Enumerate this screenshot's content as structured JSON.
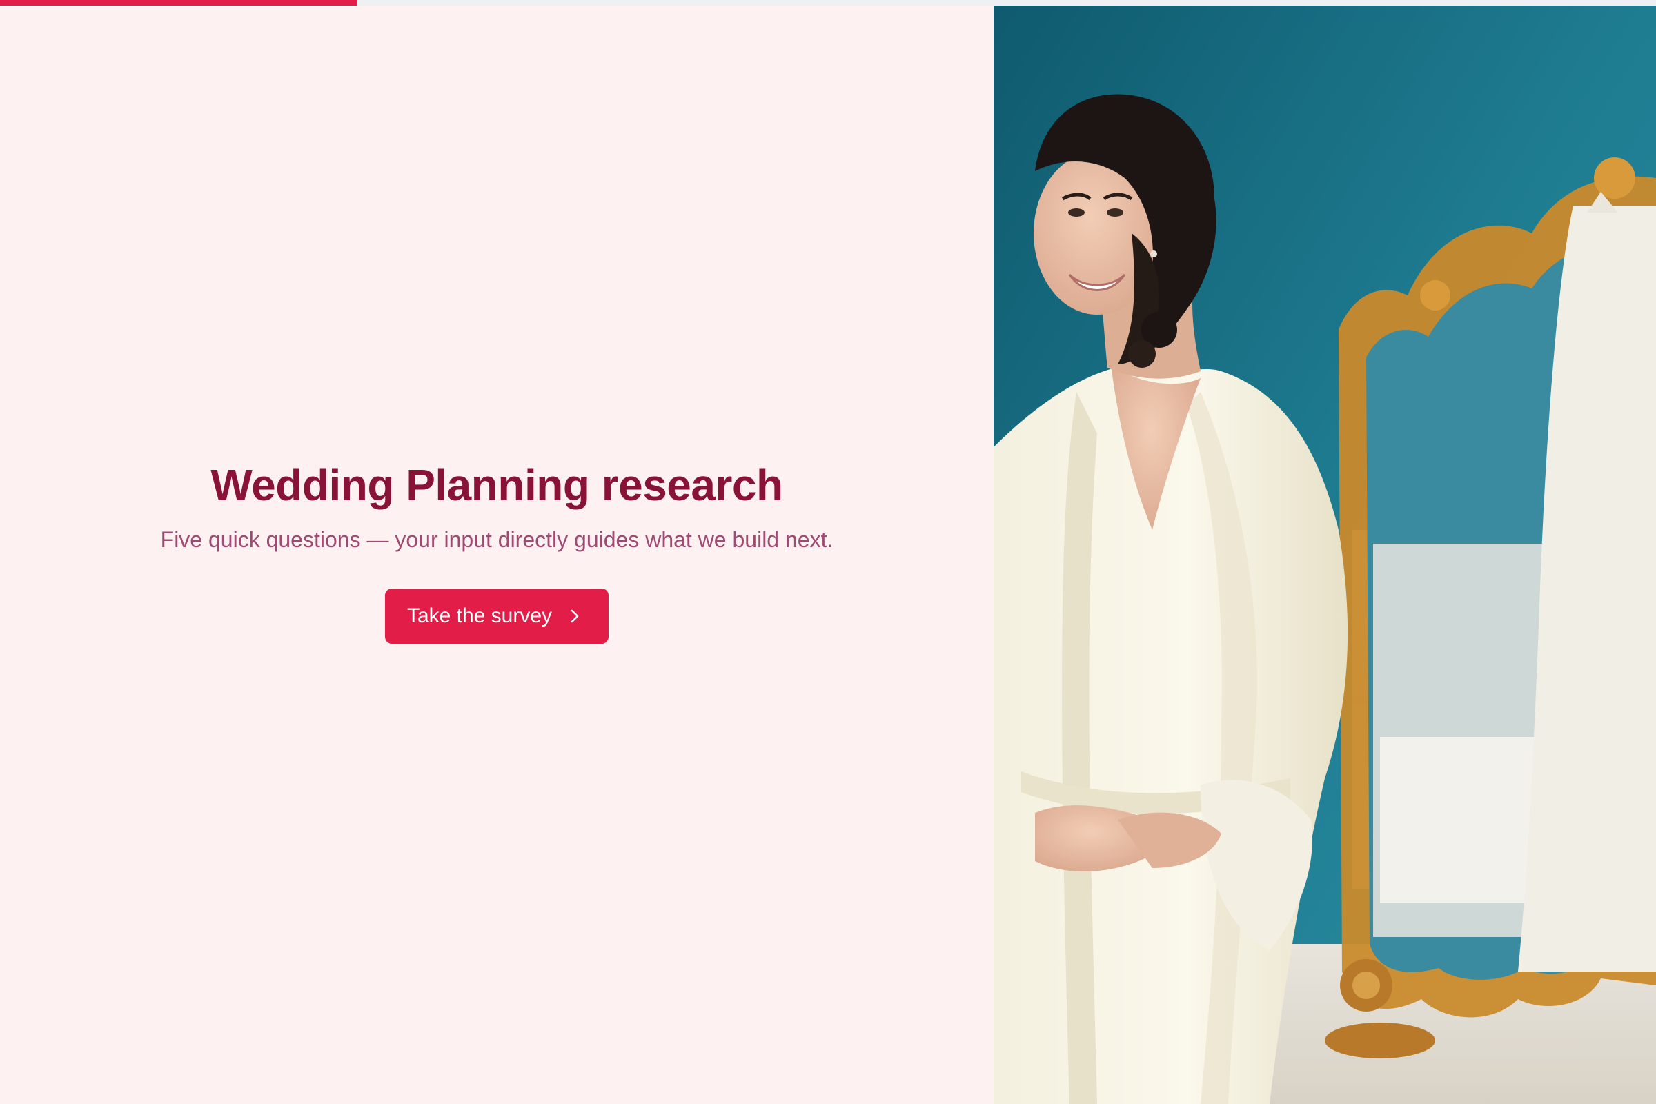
{
  "progress": {
    "fraction": 0.2155
  },
  "intro": {
    "title": "Wedding Planning research",
    "subtitle": "Five quick questions — your input directly guides what we build next.",
    "cta_label": "Take the survey",
    "cta_icon": "chevron-right-icon"
  },
  "photo": {
    "subject": "bride in ivory satin robe beside ornate gold mirror"
  },
  "colors": {
    "accent": "#e11d48",
    "title": "#881337",
    "subtitle": "#9f4a72",
    "background": "#fdf1f2",
    "progress_track": "#eef0f3"
  }
}
